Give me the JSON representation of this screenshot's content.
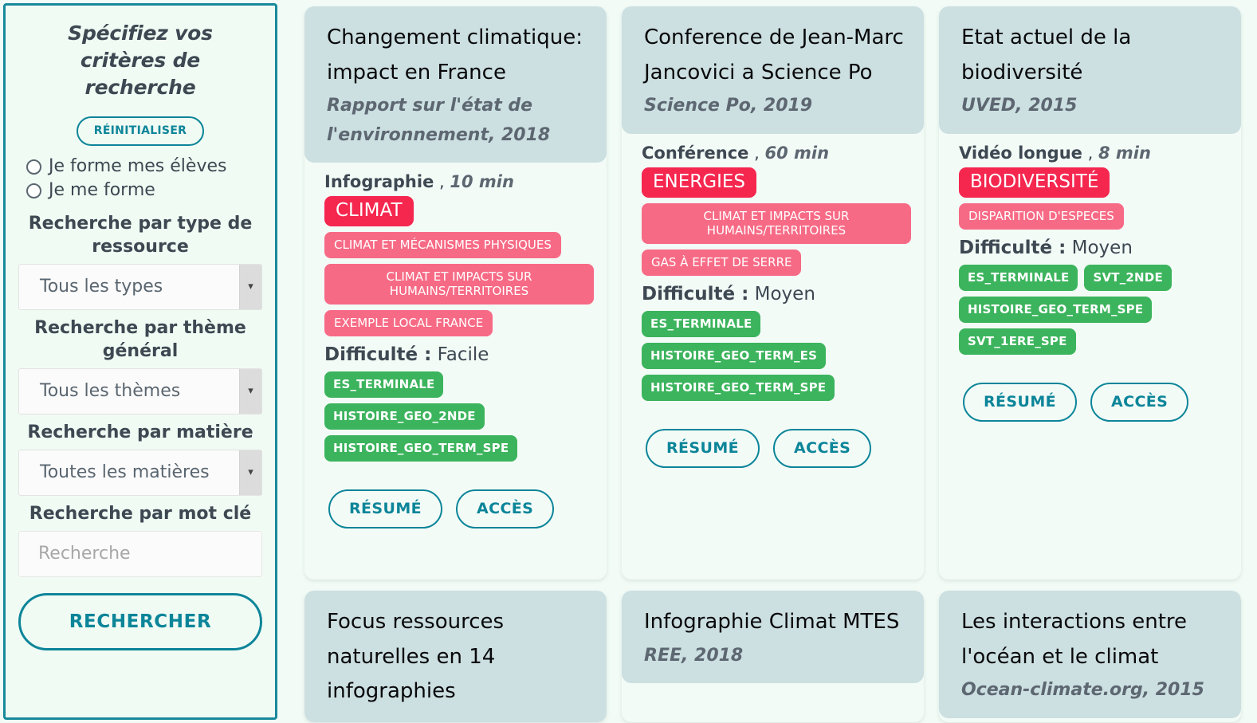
{
  "sidebar": {
    "title": "Spécifiez vos critères de recherche",
    "reset_label": "RÉINITIALISER",
    "radios": [
      {
        "label": "Je forme mes élèves"
      },
      {
        "label": "Je me forme"
      }
    ],
    "fields": [
      {
        "label": "Recherche par type de ressource",
        "value": "Tous les types"
      },
      {
        "label": "Recherche par thème général",
        "value": "Tous les thèmes"
      },
      {
        "label": "Recherche par matière",
        "value": "Toutes les matières"
      }
    ],
    "keyword_label": "Recherche par mot clé",
    "keyword_placeholder": "Recherche",
    "keyword_value": "",
    "search_label": "RECHERCHER"
  },
  "buttons": {
    "resume": "RÉSUMÉ",
    "access": "ACCÈS"
  },
  "labels": {
    "difficulty": "Difficulté :"
  },
  "colors": {
    "teal": "#0c8599",
    "theme_main": "#f5274f",
    "theme_sub": "#f76a85",
    "level": "#3cb45d",
    "card_header": "#ccdfe1",
    "page_bg": "#f2fbf6"
  },
  "cards": [
    {
      "title": "Changement climatique: impact en France",
      "source": "Rapport sur l'état de l'environnement, 2018",
      "type": "Infographie",
      "duration": "10 min",
      "theme_main": "CLIMAT",
      "themes_sub": [
        {
          "text": "CLIMAT ET MÉCANISMES PHYSIQUES",
          "wide": false
        },
        {
          "text": "CLIMAT ET IMPACTS SUR HUMAINS/TERRITOIRES",
          "wide": true
        },
        {
          "text": "EXEMPLE LOCAL FRANCE",
          "wide": false
        }
      ],
      "difficulty": "Facile",
      "levels": [
        "ES_TERMINALE",
        "HISTOIRE_GEO_2NDE",
        "HISTOIRE_GEO_TERM_SPE"
      ]
    },
    {
      "title": "Conference de Jean-Marc Jancovici a Science Po",
      "source": "Science Po, 2019",
      "type": "Conférence",
      "duration": "60 min",
      "theme_main": "ENERGIES",
      "themes_sub": [
        {
          "text": "CLIMAT ET IMPACTS SUR HUMAINS/TERRITOIRES",
          "wide": true
        },
        {
          "text": "GAS À EFFET DE SERRE",
          "wide": false
        }
      ],
      "difficulty": "Moyen",
      "levels": [
        "ES_TERMINALE",
        "HISTOIRE_GEO_TERM_ES",
        "HISTOIRE_GEO_TERM_SPE"
      ]
    },
    {
      "title": "Etat actuel de la biodiversité",
      "source": "UVED, 2015",
      "type": "Vidéo longue",
      "duration": "8 min",
      "theme_main": "BIODIVERSITÉ",
      "themes_sub": [
        {
          "text": "DISPARITION D'ESPECES",
          "wide": false
        }
      ],
      "difficulty": "Moyen",
      "levels": [
        "ES_TERMINALE",
        "SVT_2NDE",
        "HISTOIRE_GEO_TERM_SPE",
        "SVT_1ERE_SPE"
      ]
    },
    {
      "title": "Focus ressources naturelles en 14 infographies",
      "source": ""
    },
    {
      "title": "Infographie Climat MTES",
      "source": "REE, 2018"
    },
    {
      "title": "Les interactions entre l'océan et le climat",
      "source": "Ocean-climate.org, 2015"
    }
  ]
}
